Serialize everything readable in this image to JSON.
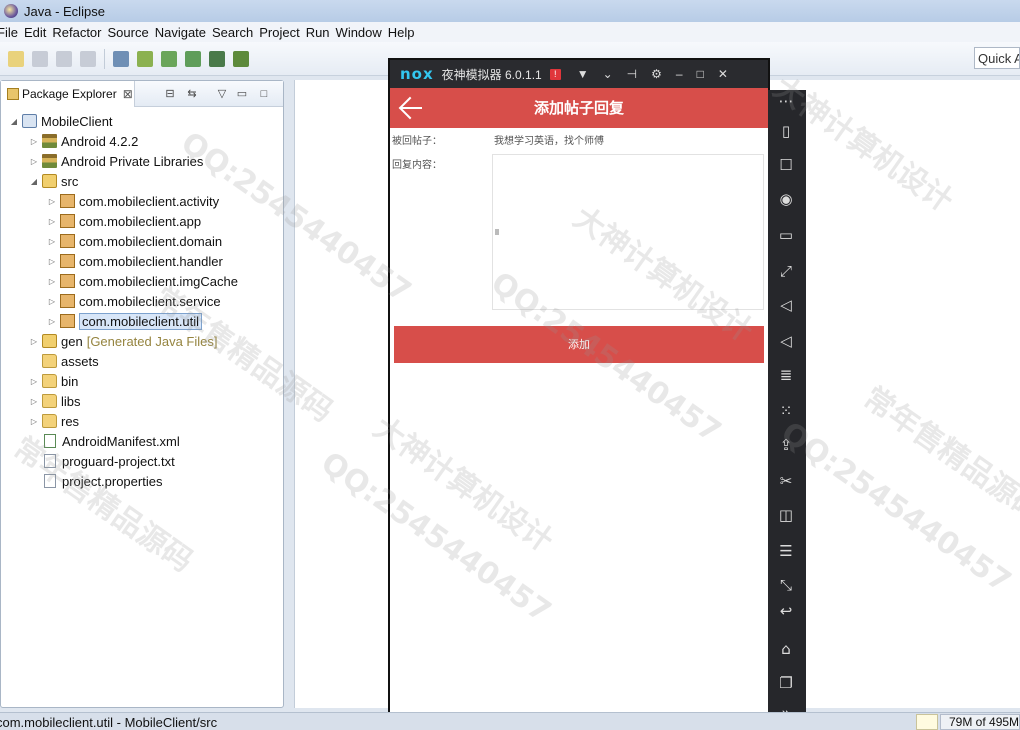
{
  "window": {
    "title": "Java - Eclipse"
  },
  "menu": [
    "File",
    "Edit",
    "Refactor",
    "Source",
    "Navigate",
    "Search",
    "Project",
    "Run",
    "Window",
    "Help"
  ],
  "toolbar": {
    "quick_access_placeholder": "Quick Access"
  },
  "package_explorer": {
    "tab_label": "Package Explorer",
    "close_glyph": "⊠",
    "project": "MobileClient",
    "items": [
      {
        "label": "Android 4.2.2"
      },
      {
        "label": "Android Private Libraries"
      },
      {
        "label": "src"
      },
      {
        "label": "com.mobileclient.activity"
      },
      {
        "label": "com.mobileclient.app"
      },
      {
        "label": "com.mobileclient.domain"
      },
      {
        "label": "com.mobileclient.handler"
      },
      {
        "label": "com.mobileclient.imgCache"
      },
      {
        "label": "com.mobileclient.service"
      },
      {
        "label": "com.mobileclient.util"
      },
      {
        "label": "gen",
        "suffix": "[Generated Java Files]"
      },
      {
        "label": "assets"
      },
      {
        "label": "bin"
      },
      {
        "label": "libs"
      },
      {
        "label": "res"
      },
      {
        "label": "AndroidManifest.xml"
      },
      {
        "label": "proguard-project.txt"
      },
      {
        "label": "project.properties"
      }
    ]
  },
  "emulator": {
    "logo": "nox",
    "title": "夜神模拟器 6.0.1.1",
    "badge": "!",
    "app": {
      "header_title": "添加帖子回复",
      "post_label": "被回帖子：",
      "post_value": "我想学习英语，找个师傅",
      "content_label": "回复内容：",
      "submit_label": "添加"
    }
  },
  "status": {
    "left_text": "com.mobileclient.util - MobileClient/src",
    "heap": "79M of 495M"
  },
  "watermark": {
    "lines": [
      "大神计算机设计",
      "QQ:2545440457",
      "常年售精品源码"
    ]
  }
}
